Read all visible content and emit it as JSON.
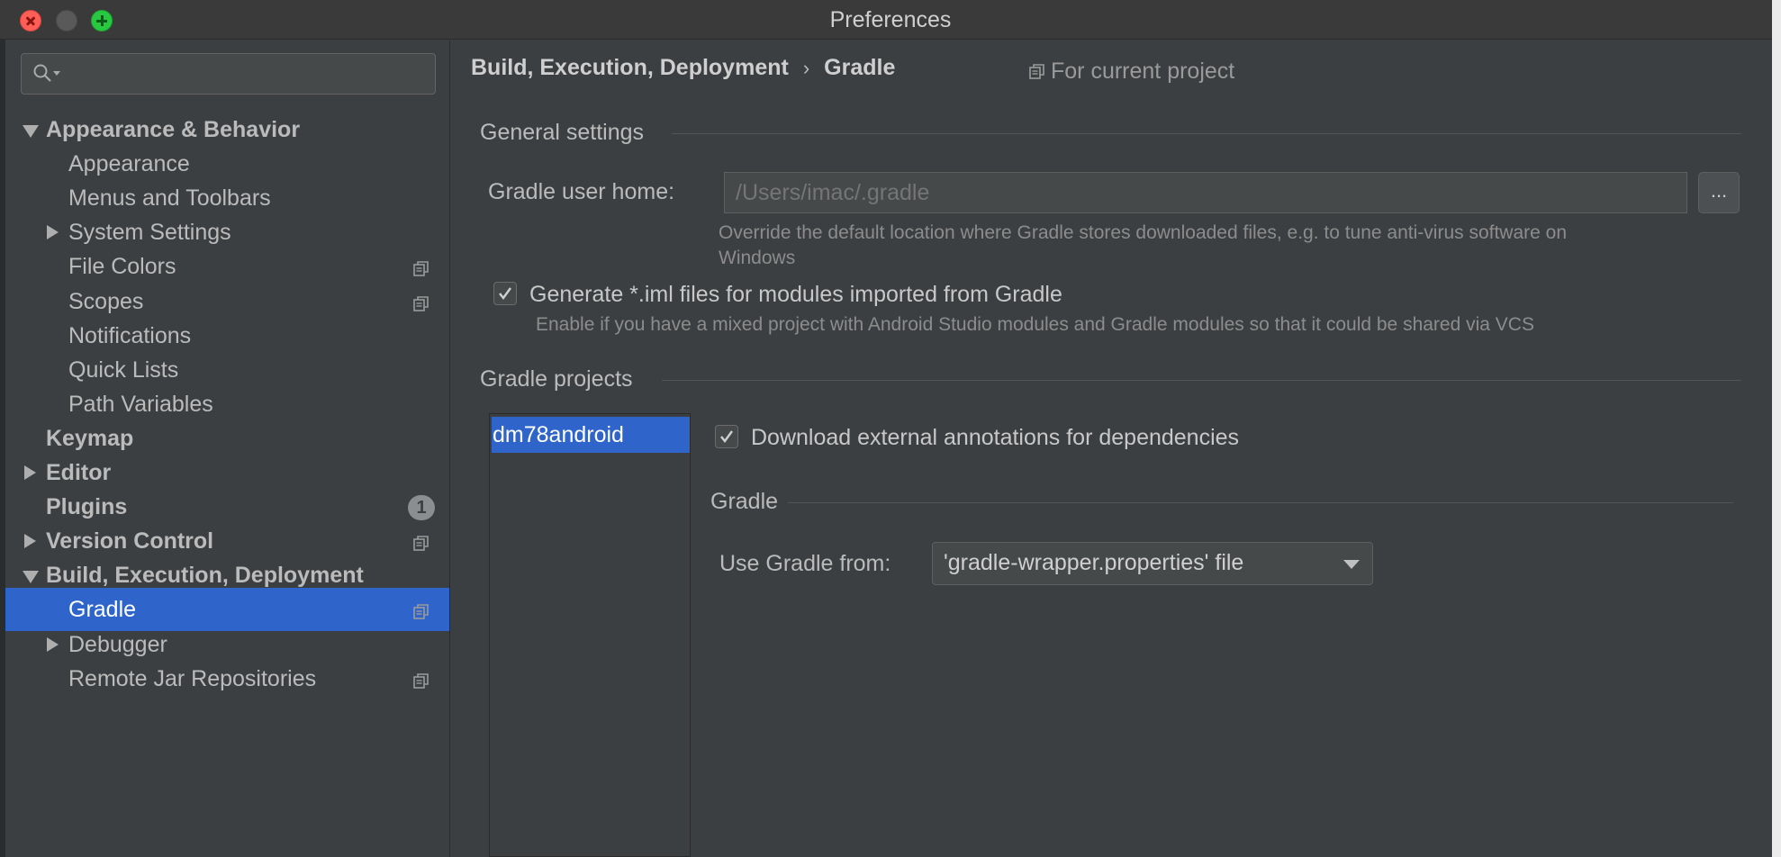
{
  "window": {
    "title": "Preferences"
  },
  "search": {
    "placeholder": "",
    "value": ""
  },
  "sidebar": {
    "items": [
      {
        "label": "Appearance & Behavior",
        "bold": true,
        "expanded": true,
        "has_arrow": true
      },
      {
        "label": "Appearance"
      },
      {
        "label": "Menus and Toolbars"
      },
      {
        "label": "System Settings",
        "has_arrow": true
      },
      {
        "label": "File Colors",
        "project_icon": true
      },
      {
        "label": "Scopes",
        "project_icon": true
      },
      {
        "label": "Notifications"
      },
      {
        "label": "Quick Lists"
      },
      {
        "label": "Path Variables"
      },
      {
        "label": "Keymap",
        "bold": true
      },
      {
        "label": "Editor",
        "bold": true,
        "has_arrow": true
      },
      {
        "label": "Plugins",
        "bold": true,
        "badge": "1"
      },
      {
        "label": "Version Control",
        "bold": true,
        "has_arrow": true,
        "project_icon": true
      },
      {
        "label": "Build, Execution, Deployment",
        "bold": true,
        "expanded": true,
        "has_arrow": true
      },
      {
        "label": "Gradle",
        "selected": true,
        "project_icon": true
      },
      {
        "label": "Debugger",
        "has_arrow": true
      },
      {
        "label": "Remote Jar Repositories",
        "project_icon": true
      }
    ]
  },
  "content": {
    "breadcrumb": {
      "parent": "Build, Execution, Deployment",
      "separator": "›",
      "current": "Gradle"
    },
    "scope_note": "For current project",
    "general_settings": {
      "title": "General settings",
      "gradle_user_home": {
        "label": "Gradle user home:",
        "placeholder": "/Users/imac/.gradle",
        "browse_label": "...",
        "hint_line1": "Override the default location where Gradle stores downloaded files, e.g. to tune anti-virus software on",
        "hint_line2": "Windows"
      },
      "generate_iml": {
        "label": "Generate *.iml files for modules imported from Gradle",
        "checked": true,
        "hint": "Enable if you have a mixed project with Android Studio modules and Gradle modules so that it could be shared via VCS"
      }
    },
    "gradle_projects": {
      "title": "Gradle projects",
      "projects": [
        "dm78android"
      ],
      "download_annotations": {
        "label": "Download external annotations for dependencies",
        "checked": true
      },
      "gradle_section_title": "Gradle",
      "use_gradle_from": {
        "label": "Use Gradle from:",
        "value": "'gradle-wrapper.properties' file"
      }
    }
  },
  "colors": {
    "selection": "#2f65ca",
    "background": "#3c3f41"
  }
}
